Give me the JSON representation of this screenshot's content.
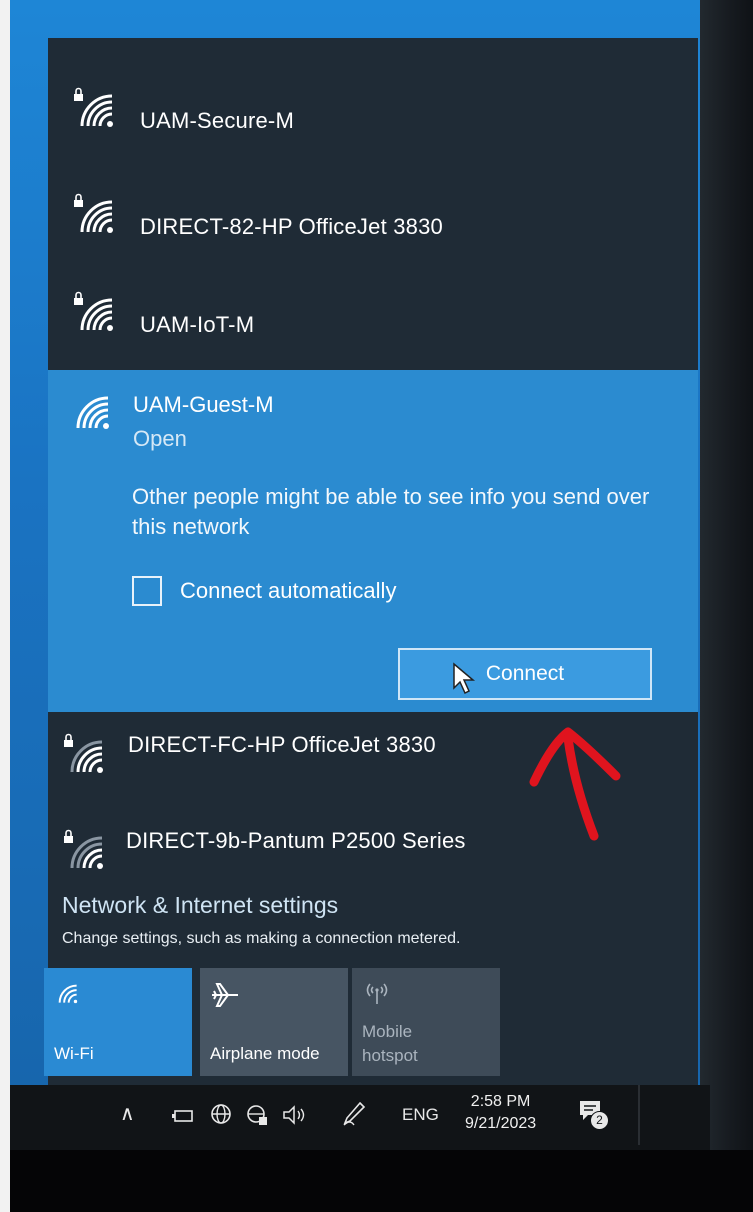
{
  "networks_top": [
    {
      "name": "UAM-Secure-M",
      "secured": true
    },
    {
      "name": "DIRECT-82-HP OfficeJet 3830",
      "secured": true
    },
    {
      "name": "UAM-IoT-M",
      "secured": true
    }
  ],
  "selected_network": {
    "name": "UAM-Guest-M",
    "status": "Open",
    "warning": "Other people might be able to see info you send over this network",
    "checkbox_label": "Connect automatically",
    "connect_label": "Connect"
  },
  "networks_bottom": [
    {
      "name": "DIRECT-FC-HP OfficeJet 3830",
      "secured": true
    },
    {
      "name": "DIRECT-9b-Pantum P2500 Series",
      "secured": true
    }
  ],
  "settings": {
    "title": "Network & Internet settings",
    "subtitle": "Change settings, such as making a connection metered."
  },
  "quick_actions": {
    "wifi_label": "Wi-Fi",
    "airplane_label": "Airplane mode",
    "hotspot_line1": "Mobile",
    "hotspot_line2": "hotspot"
  },
  "taskbar": {
    "language": "ENG",
    "time": "2:58 PM",
    "date": "9/21/2023",
    "notification_count": "2"
  },
  "colors": {
    "flyout_bg": "#1f2b36",
    "accent": "#2b8bd0",
    "annotation": "#e0141e"
  }
}
